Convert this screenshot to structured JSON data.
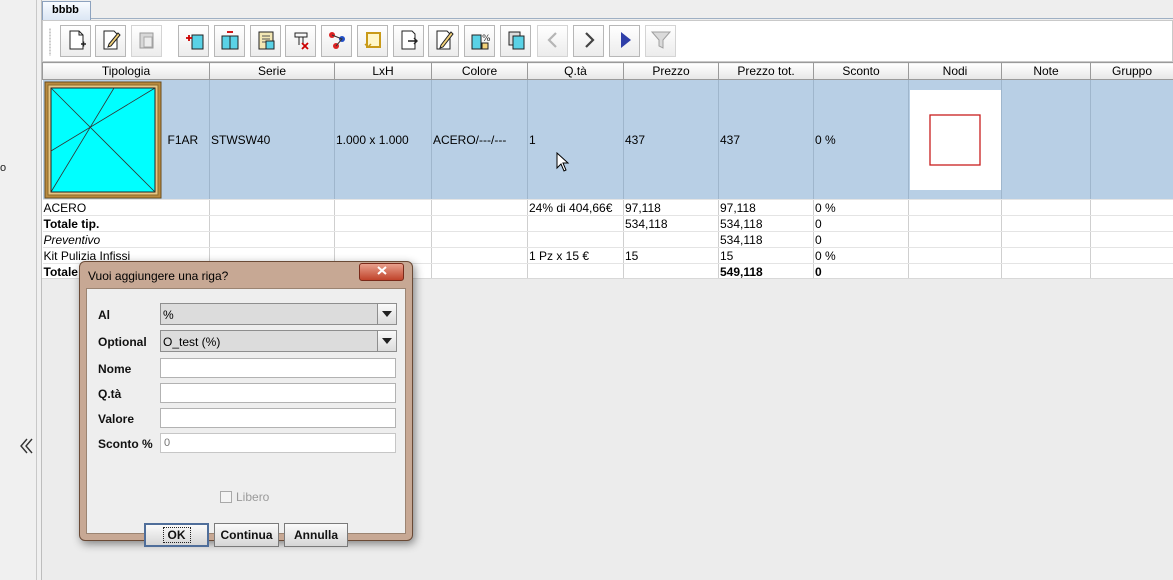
{
  "left_rail": {
    "stub_text": "o"
  },
  "tabs": [
    {
      "label": "bbbb"
    }
  ],
  "toolbar": {
    "buttons": [
      "new-document-icon",
      "edit-document-icon",
      "delete-icon",
      "add-frame-icon",
      "frame-split-icon",
      "frame-grid-icon",
      "frame-remove-icon",
      "nodes-graph-icon",
      "frame-rotate-icon",
      "document-arrow-icon",
      "edit-pen-icon",
      "percent-calc-icon",
      "copy-frame-icon",
      "back-arrow-icon",
      "forward-arrow-icon",
      "play-icon",
      "filter-icon"
    ]
  },
  "grid": {
    "columns": [
      "Tipologia",
      "Serie",
      "LxH",
      "Colore",
      "Q.tà",
      "Prezzo",
      "Prezzo tot.",
      "Sconto",
      "Nodi",
      "Note",
      "Gruppo"
    ],
    "main_row": {
      "code": "F1AR",
      "serie": "STWSW40",
      "lxh": "1.000 x 1.000",
      "colore": "ACERO/---/---",
      "qta": "1",
      "prezzo": "437",
      "prezzo_tot": "437",
      "sconto": "0 %"
    },
    "rows": [
      {
        "tipologia": "ACERO",
        "qta": "24% di 404,66€",
        "prezzo": "97,118",
        "prezzo_tot": "97,118",
        "sconto": "0 %",
        "style": "normal"
      },
      {
        "tipologia": "Totale tip.",
        "qta": "",
        "prezzo": "534,118",
        "prezzo_tot": "534,118",
        "sconto": "0",
        "style": "bold"
      },
      {
        "tipologia": "Preventivo",
        "qta": "",
        "prezzo": "",
        "prezzo_tot": "534,118",
        "sconto": "0",
        "style": "italic"
      },
      {
        "tipologia": "Kit Pulizia Infissi",
        "qta": "1 Pz x 15 €",
        "prezzo": "15",
        "prezzo_tot": "15",
        "sconto": "0 %",
        "style": "normal"
      },
      {
        "tipologia": "Totale",
        "qta": "",
        "prezzo": "",
        "prezzo_tot": "549,118",
        "sconto": "0",
        "style": "bold"
      }
    ]
  },
  "dialog": {
    "title": "Vuoi aggiungere una riga?",
    "fields": {
      "al_label": "Al",
      "al_value": "%",
      "optional_label": "Optional",
      "optional_value": "O_test (%)",
      "nome_label": "Nome",
      "nome_value": "",
      "qta_label": "Q.tà",
      "qta_value": "",
      "valore_label": "Valore",
      "valore_value": "",
      "sconto_label": "Sconto %",
      "sconto_placeholder": "0"
    },
    "libero_label": "Libero",
    "buttons": {
      "ok": "OK",
      "continua": "Continua",
      "annulla": "Annulla"
    }
  }
}
